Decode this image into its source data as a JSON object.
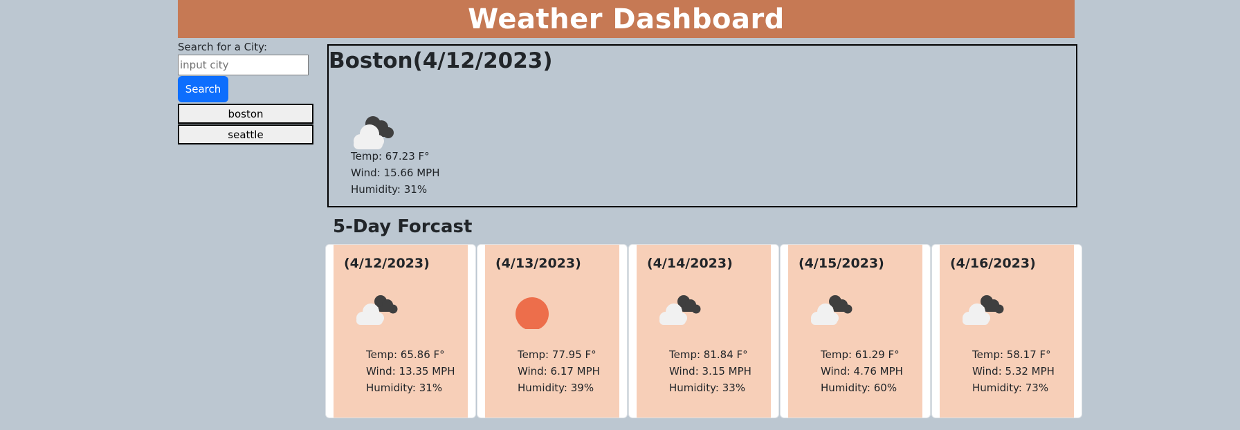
{
  "header": {
    "title": "Weather Dashboard"
  },
  "search": {
    "label": "Search for a City:",
    "placeholder": "input city",
    "button_label": "Search"
  },
  "history": [
    "boston",
    "seattle"
  ],
  "current": {
    "title": "Boston(4/12/2023)",
    "icon": "clouds-icon",
    "temp": "Temp: 67.23 F°",
    "wind": "Wind: 15.66 MPH",
    "humidity": "Humidity: 31%"
  },
  "forecast": {
    "title": "5-Day Forcast",
    "days": [
      {
        "date": "(4/12/2023)",
        "icon": "clouds-icon",
        "temp": "Temp: 65.86 F°",
        "wind": "Wind: 13.35 MPH",
        "humidity": "Humidity: 31%"
      },
      {
        "date": "(4/13/2023)",
        "icon": "sun-icon",
        "temp": "Temp: 77.95 F°",
        "wind": "Wind: 6.17 MPH",
        "humidity": "Humidity: 39%"
      },
      {
        "date": "(4/14/2023)",
        "icon": "clouds-icon",
        "temp": "Temp: 81.84 F°",
        "wind": "Wind: 3.15 MPH",
        "humidity": "Humidity: 33%"
      },
      {
        "date": "(4/15/2023)",
        "icon": "clouds-icon",
        "temp": "Temp: 61.29 F°",
        "wind": "Wind: 4.76 MPH",
        "humidity": "Humidity: 60%"
      },
      {
        "date": "(4/16/2023)",
        "icon": "clouds-icon",
        "temp": "Temp: 58.17 F°",
        "wind": "Wind: 5.32 MPH",
        "humidity": "Humidity: 73%"
      }
    ]
  },
  "colors": {
    "header_bg": "#c67954",
    "page_bg": "#bcc7d1",
    "card_bg": "#f7cfb8",
    "search_button": "#0d6efd",
    "sun": "#ed6e4b"
  }
}
